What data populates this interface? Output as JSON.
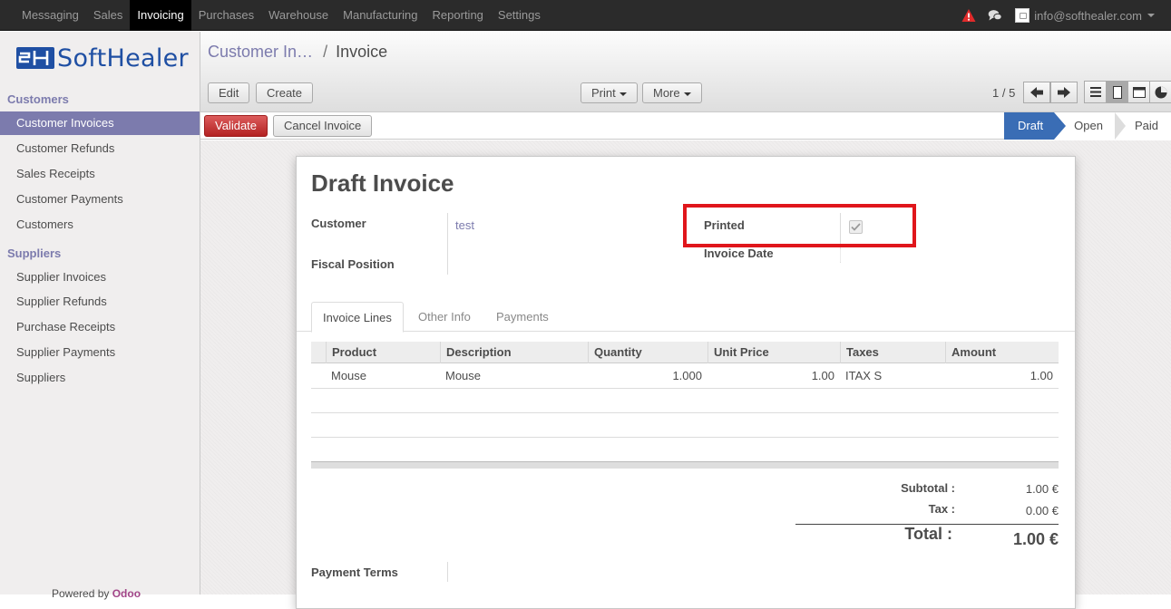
{
  "top_menu": {
    "items": [
      "Messaging",
      "Sales",
      "Invoicing",
      "Purchases",
      "Warehouse",
      "Manufacturing",
      "Reporting",
      "Settings"
    ],
    "active": "Invoicing",
    "user_email": "info@softhealer.com"
  },
  "brand": {
    "logo_text": "SoftHealer",
    "logo_color": "#1f4fa3"
  },
  "sidebar": {
    "customers_header": "Customers",
    "customers_items": [
      "Customer Invoices",
      "Customer Refunds",
      "Sales Receipts",
      "Customer Payments",
      "Customers"
    ],
    "suppliers_header": "Suppliers",
    "suppliers_items": [
      "Supplier Invoices",
      "Supplier Refunds",
      "Purchase Receipts",
      "Supplier Payments",
      "Suppliers"
    ],
    "active_item": "Customer Invoices",
    "powered_by_prefix": "Powered by",
    "powered_by_brand": "Odoo"
  },
  "breadcrumb": {
    "parent": "Customer In…",
    "separator": "/",
    "current": "Invoice"
  },
  "toolbar": {
    "edit": "Edit",
    "create": "Create",
    "print": "Print",
    "more": "More"
  },
  "pager": {
    "value": "1 / 5"
  },
  "statusbar": {
    "validate": "Validate",
    "cancel": "Cancel Invoice",
    "stages": [
      "Draft",
      "Open",
      "Paid"
    ],
    "active_stage": "Draft"
  },
  "form": {
    "title": "Draft Invoice",
    "customer_label": "Customer",
    "customer_value": "test",
    "fiscal_position_label": "Fiscal Position",
    "printed_label": "Printed",
    "printed_checked": true,
    "invoice_date_label": "Invoice Date",
    "payment_terms_label": "Payment Terms"
  },
  "tabs": [
    "Invoice Lines",
    "Other Info",
    "Payments"
  ],
  "active_tab": "Invoice Lines",
  "lines": {
    "headers": [
      "Product",
      "Description",
      "Quantity",
      "Unit Price",
      "Taxes",
      "Amount"
    ],
    "rows": [
      {
        "product": "Mouse",
        "description": "Mouse",
        "quantity": "1.000",
        "unit_price": "1.00",
        "taxes": "ITAX S",
        "amount": "1.00"
      }
    ]
  },
  "totals": {
    "subtotal_label": "Subtotal :",
    "subtotal_value": "1.00 €",
    "tax_label": "Tax :",
    "tax_value": "0.00 €",
    "total_label": "Total :",
    "total_value": "1.00 €"
  },
  "colors": {
    "accent": "#7c7bad",
    "validate": "#c0272d",
    "draft_stage": "#3a6db5",
    "highlight": "#e0161b"
  }
}
